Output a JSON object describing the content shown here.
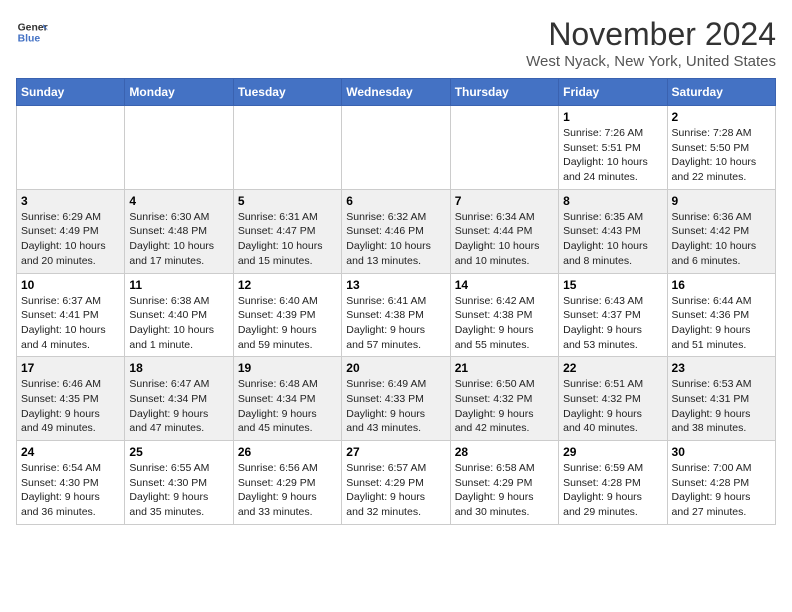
{
  "header": {
    "logo_line1": "General",
    "logo_line2": "Blue",
    "month_title": "November 2024",
    "location": "West Nyack, New York, United States"
  },
  "weekdays": [
    "Sunday",
    "Monday",
    "Tuesday",
    "Wednesday",
    "Thursday",
    "Friday",
    "Saturday"
  ],
  "weeks": [
    [
      {
        "day": "",
        "info": ""
      },
      {
        "day": "",
        "info": ""
      },
      {
        "day": "",
        "info": ""
      },
      {
        "day": "",
        "info": ""
      },
      {
        "day": "",
        "info": ""
      },
      {
        "day": "1",
        "info": "Sunrise: 7:26 AM\nSunset: 5:51 PM\nDaylight: 10 hours\nand 24 minutes."
      },
      {
        "day": "2",
        "info": "Sunrise: 7:28 AM\nSunset: 5:50 PM\nDaylight: 10 hours\nand 22 minutes."
      }
    ],
    [
      {
        "day": "3",
        "info": "Sunrise: 6:29 AM\nSunset: 4:49 PM\nDaylight: 10 hours\nand 20 minutes."
      },
      {
        "day": "4",
        "info": "Sunrise: 6:30 AM\nSunset: 4:48 PM\nDaylight: 10 hours\nand 17 minutes."
      },
      {
        "day": "5",
        "info": "Sunrise: 6:31 AM\nSunset: 4:47 PM\nDaylight: 10 hours\nand 15 minutes."
      },
      {
        "day": "6",
        "info": "Sunrise: 6:32 AM\nSunset: 4:46 PM\nDaylight: 10 hours\nand 13 minutes."
      },
      {
        "day": "7",
        "info": "Sunrise: 6:34 AM\nSunset: 4:44 PM\nDaylight: 10 hours\nand 10 minutes."
      },
      {
        "day": "8",
        "info": "Sunrise: 6:35 AM\nSunset: 4:43 PM\nDaylight: 10 hours\nand 8 minutes."
      },
      {
        "day": "9",
        "info": "Sunrise: 6:36 AM\nSunset: 4:42 PM\nDaylight: 10 hours\nand 6 minutes."
      }
    ],
    [
      {
        "day": "10",
        "info": "Sunrise: 6:37 AM\nSunset: 4:41 PM\nDaylight: 10 hours\nand 4 minutes."
      },
      {
        "day": "11",
        "info": "Sunrise: 6:38 AM\nSunset: 4:40 PM\nDaylight: 10 hours\nand 1 minute."
      },
      {
        "day": "12",
        "info": "Sunrise: 6:40 AM\nSunset: 4:39 PM\nDaylight: 9 hours\nand 59 minutes."
      },
      {
        "day": "13",
        "info": "Sunrise: 6:41 AM\nSunset: 4:38 PM\nDaylight: 9 hours\nand 57 minutes."
      },
      {
        "day": "14",
        "info": "Sunrise: 6:42 AM\nSunset: 4:38 PM\nDaylight: 9 hours\nand 55 minutes."
      },
      {
        "day": "15",
        "info": "Sunrise: 6:43 AM\nSunset: 4:37 PM\nDaylight: 9 hours\nand 53 minutes."
      },
      {
        "day": "16",
        "info": "Sunrise: 6:44 AM\nSunset: 4:36 PM\nDaylight: 9 hours\nand 51 minutes."
      }
    ],
    [
      {
        "day": "17",
        "info": "Sunrise: 6:46 AM\nSunset: 4:35 PM\nDaylight: 9 hours\nand 49 minutes."
      },
      {
        "day": "18",
        "info": "Sunrise: 6:47 AM\nSunset: 4:34 PM\nDaylight: 9 hours\nand 47 minutes."
      },
      {
        "day": "19",
        "info": "Sunrise: 6:48 AM\nSunset: 4:34 PM\nDaylight: 9 hours\nand 45 minutes."
      },
      {
        "day": "20",
        "info": "Sunrise: 6:49 AM\nSunset: 4:33 PM\nDaylight: 9 hours\nand 43 minutes."
      },
      {
        "day": "21",
        "info": "Sunrise: 6:50 AM\nSunset: 4:32 PM\nDaylight: 9 hours\nand 42 minutes."
      },
      {
        "day": "22",
        "info": "Sunrise: 6:51 AM\nSunset: 4:32 PM\nDaylight: 9 hours\nand 40 minutes."
      },
      {
        "day": "23",
        "info": "Sunrise: 6:53 AM\nSunset: 4:31 PM\nDaylight: 9 hours\nand 38 minutes."
      }
    ],
    [
      {
        "day": "24",
        "info": "Sunrise: 6:54 AM\nSunset: 4:30 PM\nDaylight: 9 hours\nand 36 minutes."
      },
      {
        "day": "25",
        "info": "Sunrise: 6:55 AM\nSunset: 4:30 PM\nDaylight: 9 hours\nand 35 minutes."
      },
      {
        "day": "26",
        "info": "Sunrise: 6:56 AM\nSunset: 4:29 PM\nDaylight: 9 hours\nand 33 minutes."
      },
      {
        "day": "27",
        "info": "Sunrise: 6:57 AM\nSunset: 4:29 PM\nDaylight: 9 hours\nand 32 minutes."
      },
      {
        "day": "28",
        "info": "Sunrise: 6:58 AM\nSunset: 4:29 PM\nDaylight: 9 hours\nand 30 minutes."
      },
      {
        "day": "29",
        "info": "Sunrise: 6:59 AM\nSunset: 4:28 PM\nDaylight: 9 hours\nand 29 minutes."
      },
      {
        "day": "30",
        "info": "Sunrise: 7:00 AM\nSunset: 4:28 PM\nDaylight: 9 hours\nand 27 minutes."
      }
    ]
  ]
}
